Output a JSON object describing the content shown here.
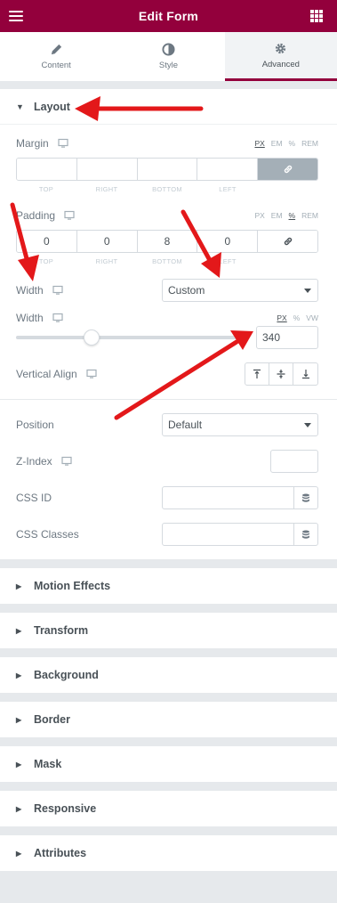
{
  "header": {
    "title": "Edit Form",
    "menu_icon": "hamburger-icon",
    "apps_icon": "grid-icon"
  },
  "tabs": [
    {
      "label": "Content",
      "icon": "pencil-icon",
      "active": false
    },
    {
      "label": "Style",
      "icon": "half-circle-icon",
      "active": false
    },
    {
      "label": "Advanced",
      "icon": "gear-icon",
      "active": true
    }
  ],
  "layout": {
    "title": "Layout",
    "margin": {
      "label": "Margin",
      "units": [
        "PX",
        "EM",
        "%",
        "REM"
      ],
      "active_unit": "PX",
      "values": [
        "",
        "",
        "",
        ""
      ],
      "linked": true
    },
    "padding": {
      "label": "Padding",
      "units": [
        "PX",
        "EM",
        "%",
        "REM"
      ],
      "active_unit": "%",
      "values": [
        "0",
        "0",
        "8",
        "0"
      ],
      "linked": false
    },
    "dim_labels": [
      "TOP",
      "RIGHT",
      "BOTTOM",
      "LEFT"
    ],
    "width_select": {
      "label": "Width",
      "value": "Custom"
    },
    "width_slider": {
      "label": "Width",
      "units": [
        "PX",
        "%",
        "VW"
      ],
      "active_unit": "PX",
      "value": "340",
      "level": 0.34
    },
    "vertical_align": {
      "label": "Vertical Align"
    },
    "position": {
      "label": "Position",
      "value": "Default"
    },
    "z_index": {
      "label": "Z-Index"
    },
    "css_id": {
      "label": "CSS ID"
    },
    "css_classes": {
      "label": "CSS Classes"
    }
  },
  "sections": [
    {
      "label": "Motion Effects"
    },
    {
      "label": "Transform"
    },
    {
      "label": "Background"
    },
    {
      "label": "Border"
    },
    {
      "label": "Mask"
    },
    {
      "label": "Responsive"
    },
    {
      "label": "Attributes"
    }
  ],
  "colors": {
    "brand": "#93003c",
    "arrow": "#e3181a"
  }
}
